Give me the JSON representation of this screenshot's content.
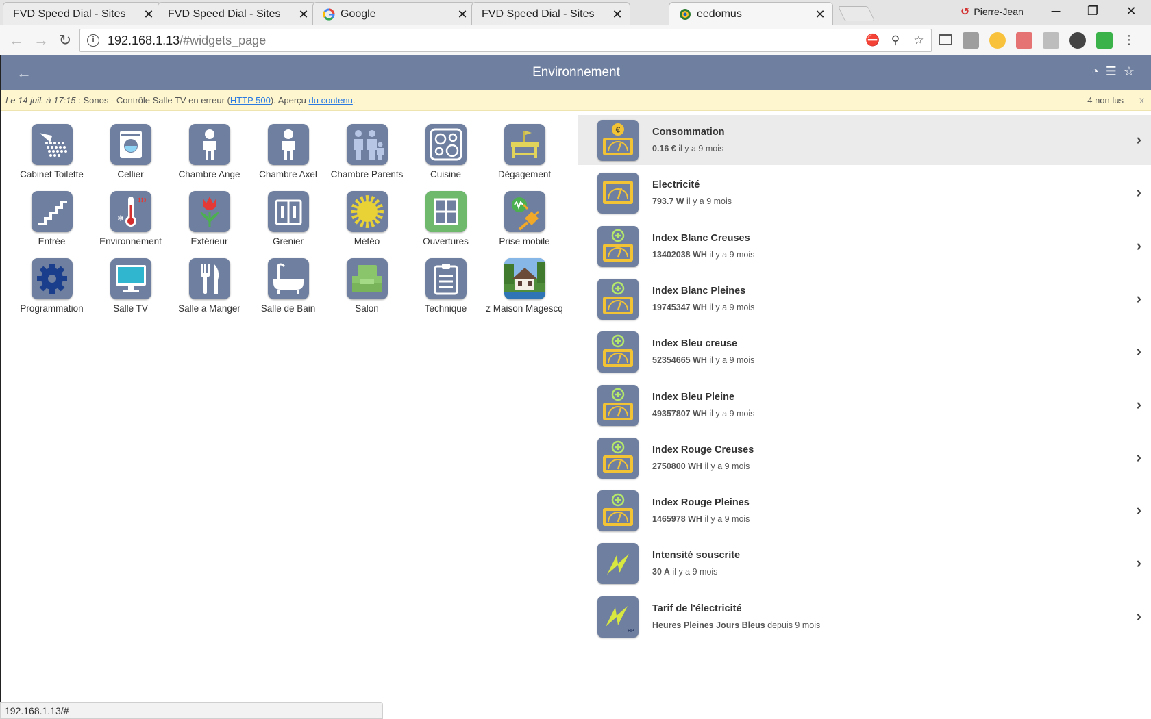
{
  "browser": {
    "tabs": [
      {
        "title": "FVD Speed Dial - Sites",
        "icon": "none",
        "active": false
      },
      {
        "title": "FVD Speed Dial - Sites",
        "icon": "none",
        "active": false
      },
      {
        "title": "Google",
        "icon": "google-icon",
        "active": false
      },
      {
        "title": "FVD Speed Dial - Sites",
        "icon": "none",
        "active": false
      },
      {
        "title": "eedomus",
        "icon": "eedomus-icon",
        "active": true
      }
    ],
    "profile_name": "Pierre-Jean",
    "url_host": "192.168.1.13",
    "url_path": "/#widgets_page",
    "status_url": "192.168.1.13/#"
  },
  "header": {
    "title": "Environnement",
    "accent_color": "#6f7f9f"
  },
  "notification": {
    "date": "Le 14 juil. à 17:15",
    "message_start": " : Sonos - Contrôle Salle TV en erreur (",
    "link_error": "HTTP 500",
    "message_mid": "). Aperçu ",
    "link_preview": "du contenu",
    "message_end": ".",
    "unread": "4 non lus",
    "close": "x"
  },
  "rooms": [
    {
      "label": "Cabinet Toilette",
      "icon": "shower-icon"
    },
    {
      "label": "Cellier",
      "icon": "washing-machine-icon"
    },
    {
      "label": "Chambre Ange",
      "icon": "child-icon"
    },
    {
      "label": "Chambre Axel",
      "icon": "child-icon"
    },
    {
      "label": "Chambre Parents",
      "icon": "family-icon"
    },
    {
      "label": "Cuisine",
      "icon": "stove-icon"
    },
    {
      "label": "Dégagement",
      "icon": "console-table-icon"
    },
    {
      "label": "Entrée",
      "icon": "stairs-icon"
    },
    {
      "label": "Environnement",
      "icon": "thermometer-icon"
    },
    {
      "label": "Extérieur",
      "icon": "tulip-icon"
    },
    {
      "label": "Grenier",
      "icon": "wardrobe-icon"
    },
    {
      "label": "Météo",
      "icon": "sun-icon"
    },
    {
      "label": "Ouvertures",
      "icon": "window-icon"
    },
    {
      "label": "Prise mobile",
      "icon": "plug-icon"
    },
    {
      "label": "Programmation",
      "icon": "gear-icon"
    },
    {
      "label": "Salle TV",
      "icon": "tv-icon"
    },
    {
      "label": "Salle a Manger",
      "icon": "cutlery-icon"
    },
    {
      "label": "Salle de Bain",
      "icon": "bathtub-icon"
    },
    {
      "label": "Salon",
      "icon": "sofa-icon"
    },
    {
      "label": "Technique",
      "icon": "clipboard-icon"
    },
    {
      "label": "z Maison Magescq",
      "icon": "house-photo-icon"
    }
  ],
  "widgets": [
    {
      "name": "Consommation",
      "value": "0.16 €",
      "suffix": " il y a 9 mois",
      "icon": "meter-euro-icon",
      "selected": true
    },
    {
      "name": "Electricité",
      "value": "793.7 W",
      "suffix": " il y a 9 mois",
      "icon": "meter-icon",
      "selected": false
    },
    {
      "name": "Index Blanc Creuses",
      "value": "13402038 WH",
      "suffix": " il y a 9 mois",
      "icon": "meter-plus-icon",
      "selected": false
    },
    {
      "name": "Index Blanc Pleines",
      "value": "19745347 WH",
      "suffix": " il y a 9 mois",
      "icon": "meter-plus-icon",
      "selected": false
    },
    {
      "name": "Index Bleu creuse",
      "value": "52354665 WH",
      "suffix": " il y a 9 mois",
      "icon": "meter-plus-icon",
      "selected": false
    },
    {
      "name": "Index Bleu Pleine",
      "value": "49357807 WH",
      "suffix": " il y a 9 mois",
      "icon": "meter-plus-icon",
      "selected": false
    },
    {
      "name": "Index Rouge Creuses",
      "value": "2750800 WH",
      "suffix": " il y a 9 mois",
      "icon": "meter-plus-icon",
      "selected": false
    },
    {
      "name": "Index Rouge Pleines",
      "value": "1465978 WH",
      "suffix": " il y a 9 mois",
      "icon": "meter-plus-icon",
      "selected": false
    },
    {
      "name": "Intensité souscrite",
      "value": "30 A",
      "suffix": " il y a 9 mois",
      "icon": "lightning-icon",
      "selected": false
    },
    {
      "name": "Tarif de l'électricité",
      "value": "Heures Pleines Jours Bleus",
      "suffix": " depuis 9 mois",
      "icon": "lightning-hp-icon",
      "selected": false
    }
  ]
}
